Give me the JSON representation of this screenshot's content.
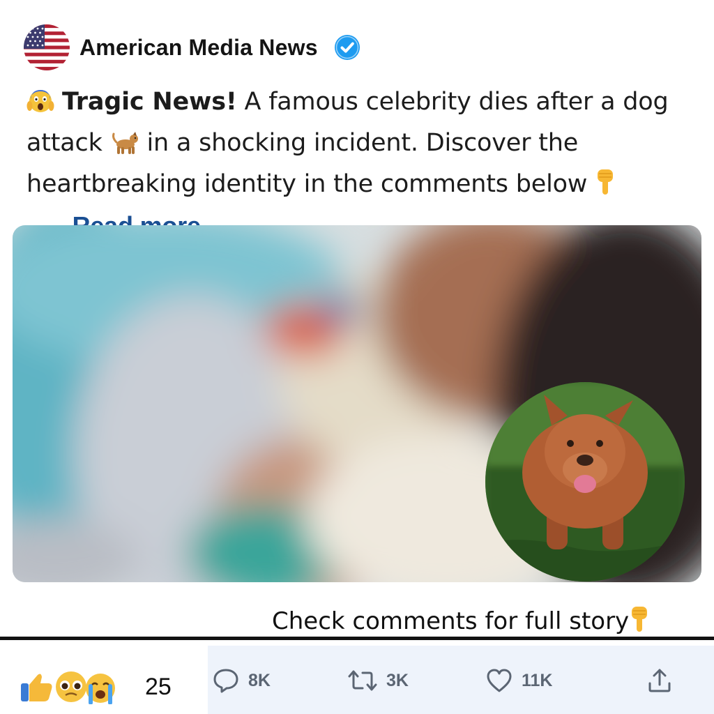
{
  "post": {
    "account_name": "American Media News",
    "verified": true,
    "avatar_icon": "us-flag-icon",
    "text": {
      "lead_emoji": "😱",
      "headline": "Tragic News!",
      "body_1": " A famous celebrity dies after a dog attack ",
      "dog_emoji": "🐕",
      "body_2": " in a shocking incident. Discover the heartbreaking identity in the comments below ",
      "pointer_emoji": "👇",
      "ellipsis": "......",
      "read_more": "Read more"
    },
    "caption": "Check comments for full story",
    "caption_emoji": "👇"
  },
  "reactions": {
    "icons": [
      "thumbs-up-icon",
      "pleading-face-icon",
      "crying-face-icon"
    ],
    "count": "25"
  },
  "actions": {
    "replies": "8K",
    "reposts": "3K",
    "likes": "11K"
  },
  "colors": {
    "accent_link": "#1a4f93",
    "verified_blue": "#1d9bf0",
    "action_bar_bg": "#eef3fb",
    "action_text": "#5b6573"
  }
}
